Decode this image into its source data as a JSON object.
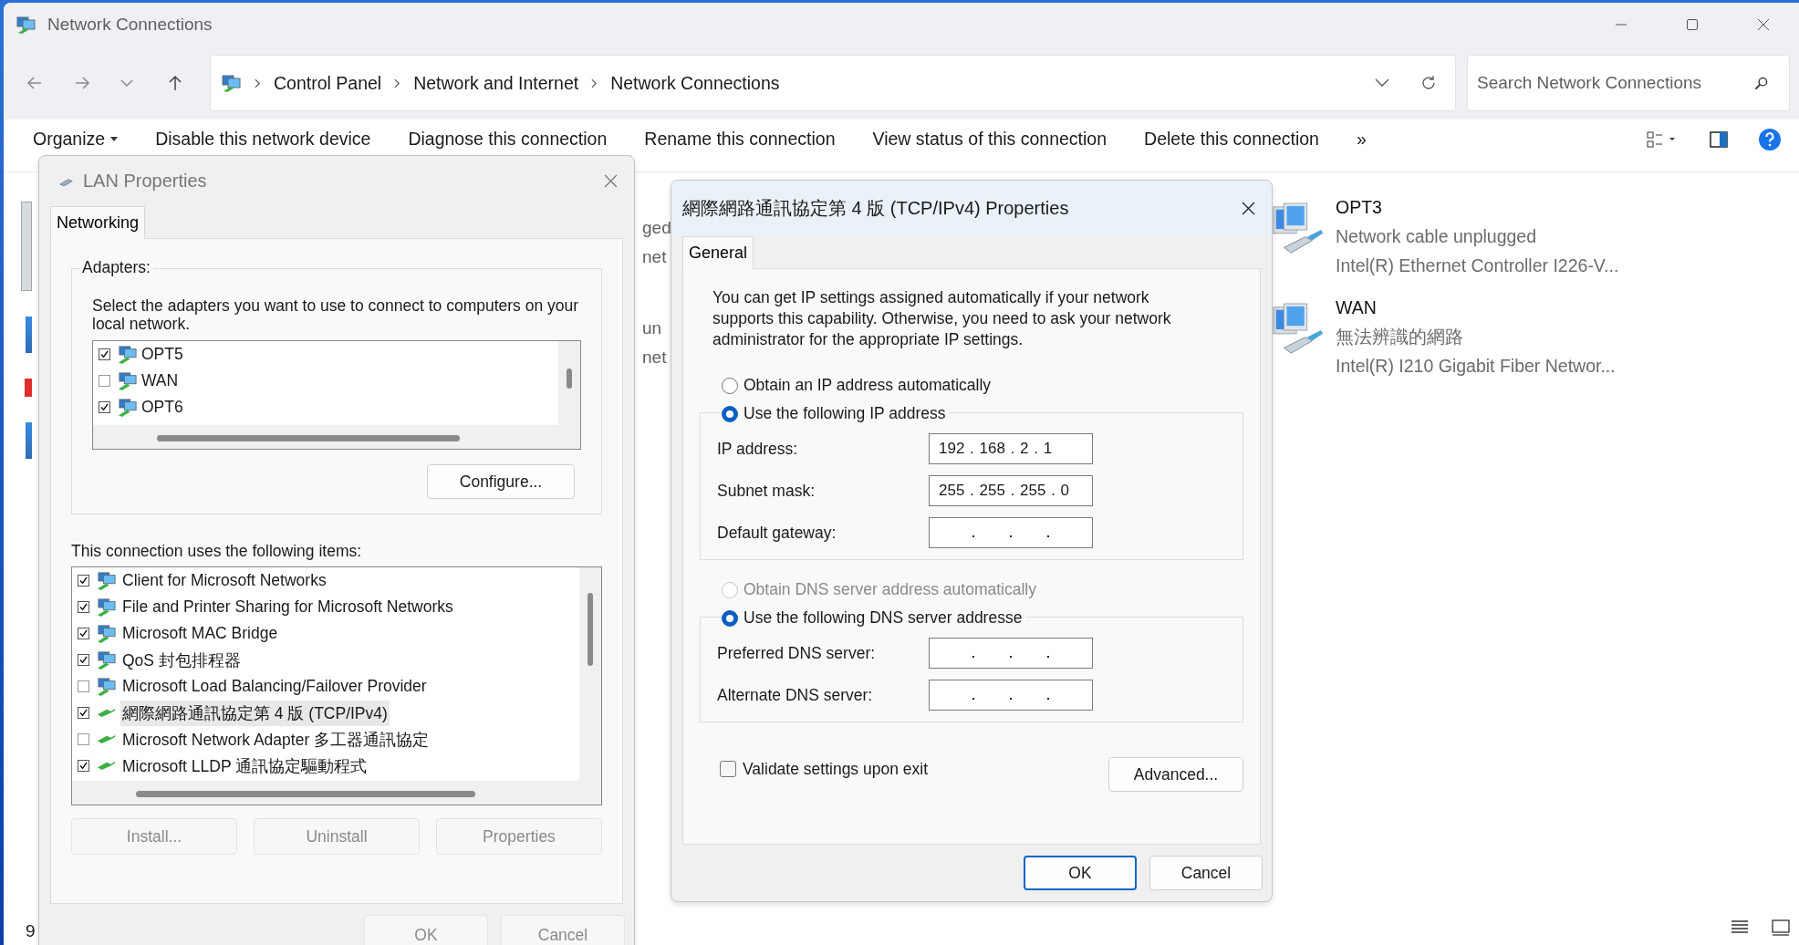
{
  "window": {
    "title": "Network Connections"
  },
  "address": {
    "breadcrumb": [
      "Control Panel",
      "Network and Internet",
      "Network Connections"
    ]
  },
  "search": {
    "placeholder": "Search Network Connections"
  },
  "commands": [
    {
      "label": "Organize",
      "dropdown": true
    },
    {
      "label": "Disable this network device",
      "dropdown": false
    },
    {
      "label": "Diagnose this connection",
      "dropdown": false
    },
    {
      "label": "Rename this connection",
      "dropdown": false
    },
    {
      "label": "View status of this connection",
      "dropdown": false
    },
    {
      "label": "Delete this connection",
      "dropdown": false
    },
    {
      "label": "»",
      "dropdown": false
    }
  ],
  "column_2_fragments": [
    "ged",
    "net",
    "un",
    "net"
  ],
  "connections": [
    {
      "name": "OPT3",
      "status": "Network cable unplugged",
      "device": "Intel(R) Ethernet Controller I226-V..."
    },
    {
      "name": "WAN",
      "status": "無法辨識的網路",
      "device": "Intel(R) I210 Gigabit Fiber Networ..."
    }
  ],
  "status_bar": {
    "count": "9"
  },
  "lan_dialog": {
    "title": "LAN Properties",
    "tabs": [
      {
        "label": "Networking",
        "selected": true
      }
    ],
    "adapters_label": "Adapters:",
    "adapters_hint": "Select the adapters you want to use to connect to computers on your local network.",
    "adapters": [
      {
        "name": "OPT5",
        "checked": true
      },
      {
        "name": "WAN",
        "checked": false
      },
      {
        "name": "OPT6",
        "checked": true
      }
    ],
    "configure": "Configure...",
    "items_label": "This connection uses the following items:",
    "items": [
      {
        "label": "Client for Microsoft Networks",
        "kind": "client",
        "checked": true,
        "selected": false
      },
      {
        "label": "File and Printer Sharing for Microsoft Networks",
        "kind": "client",
        "checked": true,
        "selected": false
      },
      {
        "label": "Microsoft MAC Bridge",
        "kind": "client",
        "checked": true,
        "selected": false
      },
      {
        "label": "QoS 封包排程器",
        "kind": "client",
        "checked": true,
        "selected": false
      },
      {
        "label": "Microsoft Load Balancing/Failover Provider",
        "kind": "client",
        "checked": false,
        "selected": false
      },
      {
        "label": "網際網路通訊協定第 4 版 (TCP/IPv4)",
        "kind": "protocol",
        "checked": true,
        "selected": true
      },
      {
        "label": "Microsoft Network Adapter 多工器通訊協定",
        "kind": "protocol",
        "checked": false,
        "selected": false
      },
      {
        "label": "Microsoft LLDP 通訊協定驅動程式",
        "kind": "protocol",
        "checked": true,
        "selected": false
      }
    ],
    "item_buttons": [
      {
        "label": "Install...",
        "disabled": true
      },
      {
        "label": "Uninstall",
        "disabled": true
      },
      {
        "label": "Properties",
        "disabled": true
      }
    ],
    "buttons": [
      {
        "label": "OK",
        "disabled": true
      },
      {
        "label": "Cancel",
        "disabled": true
      }
    ]
  },
  "tcp_dialog": {
    "title": "網際網路通訊協定第 4 版 (TCP/IPv4) Properties",
    "tabs": [
      {
        "label": "General",
        "selected": true
      }
    ],
    "intro": "You can get IP settings assigned automatically if your network supports this capability. Otherwise, you need to ask your network administrator for the appropriate IP settings.",
    "ip_auto": {
      "label": "Obtain an IP address automatically",
      "selected": false,
      "disabled": false
    },
    "ip_manual": {
      "label": "Use the following IP address",
      "selected": true,
      "disabled": false
    },
    "ip_fields": [
      {
        "label": "IP address:",
        "value": "192 . 168 . 2 . 1"
      },
      {
        "label": "Subnet mask:",
        "value": "255 . 255 . 255 . 0"
      },
      {
        "label": "Default gateway:"
      }
    ],
    "dns_auto": {
      "label": "Obtain DNS server address automatically",
      "selected": false,
      "disabled": true
    },
    "dns_manual": {
      "label": "Use the following DNS server addresse",
      "selected": true,
      "disabled": false
    },
    "dns_fields": [
      {
        "label": "Preferred DNS server:"
      },
      {
        "label": "Alternate DNS server:"
      }
    ],
    "validate": {
      "label": "Validate settings upon exit",
      "checked": false
    },
    "advanced": "Advanced...",
    "buttons": [
      {
        "label": "OK",
        "default": true
      },
      {
        "label": "Cancel",
        "default": false
      }
    ]
  }
}
